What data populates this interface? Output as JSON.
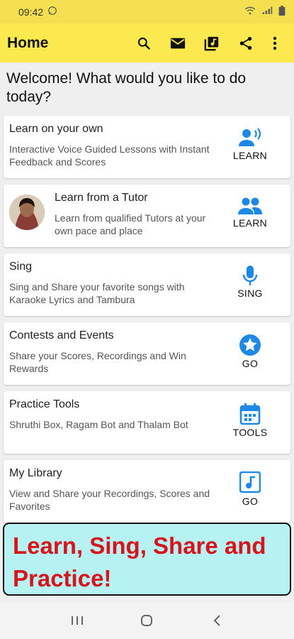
{
  "status_bar": {
    "time": "09:42",
    "icons": [
      "whatsapp-icon",
      "wifi-icon",
      "signal-icon",
      "battery-icon"
    ]
  },
  "app_bar": {
    "title": "Home",
    "actions": [
      "search-icon",
      "mail-icon",
      "library-music-icon",
      "share-icon",
      "more-vert-icon"
    ]
  },
  "welcome": "Welcome! What would you like to do today?",
  "cards": [
    {
      "title": "Learn on your own",
      "description": "Interactive Voice Guided Lessons with Instant Feedback and Scores",
      "action": "LEARN",
      "icon": "record-voice-icon"
    },
    {
      "title": "Learn from a Tutor",
      "description": "Learn from qualified Tutors at your own pace and place",
      "action": "LEARN",
      "icon": "people-icon"
    },
    {
      "title": "Sing",
      "description": "Sing and Share your favorite songs with Karaoke Lyrics and Tambura",
      "action": "SING",
      "icon": "mic-icon"
    },
    {
      "title": "Contests and Events",
      "description": "Share your Scores, Recordings and Win Rewards",
      "action": "GO",
      "icon": "star-circle-icon"
    },
    {
      "title": "Practice Tools",
      "description": "Shruthi Box, Ragam Bot and Thalam Bot",
      "action": "TOOLS",
      "icon": "calendar-icon"
    },
    {
      "title": "My Library",
      "description": "View and Share your Recordings, Scores and Favorites",
      "action": "GO",
      "icon": "music-note-icon"
    }
  ],
  "promo": {
    "line1": "Learn, Sing, Share and",
    "line2": "Practice!"
  },
  "colors": {
    "app_bar": "#fbe94f",
    "accent_blue": "#1e88e5",
    "promo_bg": "#b6f2f2",
    "promo_text": "#d8131c"
  }
}
